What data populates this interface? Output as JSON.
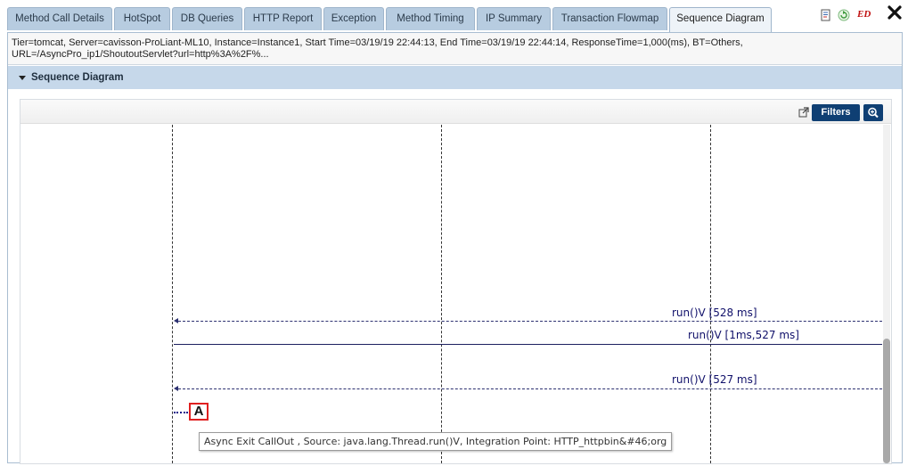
{
  "tabs": [
    {
      "label": "Method Call Details"
    },
    {
      "label": "HotSpot"
    },
    {
      "label": "DB Queries"
    },
    {
      "label": "HTTP Report"
    },
    {
      "label": "Exception"
    },
    {
      "label": "Method Timing"
    },
    {
      "label": "IP Summary"
    },
    {
      "label": "Transaction Flowmap"
    },
    {
      "label": "Sequence Diagram",
      "active": true
    }
  ],
  "toolbar_icons": [
    "document-icon",
    "refresh-icon",
    "ed-icon",
    "close-icon"
  ],
  "ed_label": "ED",
  "info": {
    "line1": "Tier=tomcat, Server=cavisson-ProLiant-ML10, Instance=Instance1, Start Time=03/19/19 22:44:13, End Time=03/19/19 22:44:14, ResponseTime=1,000(ms), BT=Others,",
    "line2": "URL=/AsyncPro_ip1/ShoutoutServlet?url=http%3A%2F%..."
  },
  "section": {
    "title": "Sequence Diagram"
  },
  "diagram_toolbar": {
    "filters_label": "Filters"
  },
  "messages": [
    {
      "label": "run()V [528 ms]",
      "style": "dotted-return"
    },
    {
      "label": "run()V  [1ms,527 ms]",
      "style": "solid-call"
    },
    {
      "label": "run()V [527 ms]",
      "style": "dotted-return"
    }
  ],
  "marker": {
    "label": "A"
  },
  "tooltip": {
    "text": "Async Exit CallOut , Source: java.lang.Thread.run()V, Integration Point: HTTP_httpbin&#46;org"
  },
  "colors": {
    "tab_bg": "#b7cce0",
    "section_bg": "#c6d8ea",
    "button_bg": "#0f3f73",
    "marker_border": "#e02020"
  }
}
